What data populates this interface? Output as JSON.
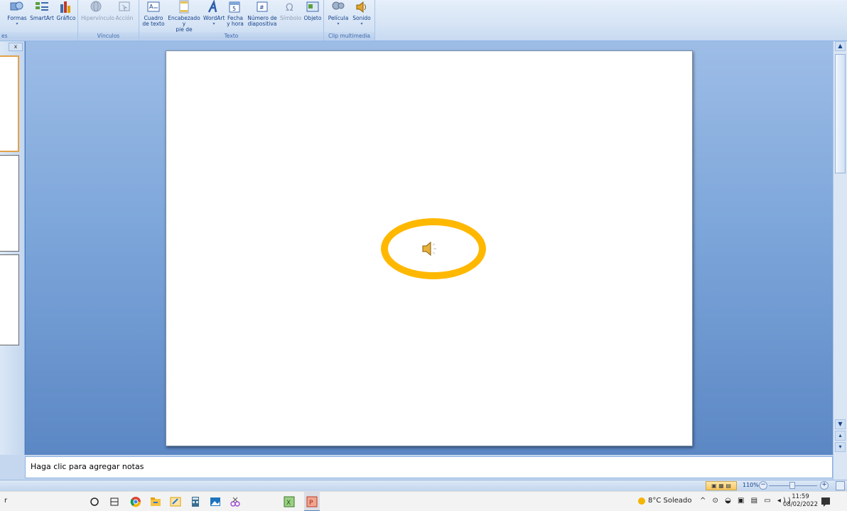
{
  "ribbon": {
    "groups": {
      "ilustraciones_partial": "es",
      "vinculos": "Vínculos",
      "texto": "Texto",
      "clip": "Clip multimedia"
    },
    "buttons": {
      "formas": "Formas",
      "smartart": "SmartArt",
      "grafico": "Gráfico",
      "hipervinculo": "Hipervínculo",
      "accion": "Acción",
      "cuadro_texto_1": "Cuadro",
      "cuadro_texto_2": "de texto",
      "encabezado_1": "Encabezado y",
      "encabezado_2": "pie de página",
      "wordart": "WordArt",
      "fecha_1": "Fecha",
      "fecha_2": "y hora",
      "numero_1": "Número de",
      "numero_2": "diapositiva",
      "simbolo": "Símbolo",
      "objeto": "Objeto",
      "pelicula": "Película",
      "sonido": "Sonido"
    }
  },
  "left_pane": {
    "close": "x"
  },
  "notes": {
    "placeholder": "Haga clic para agregar notas"
  },
  "statusbar": {
    "zoom": "110%",
    "zoom_value": 110
  },
  "taskbar": {
    "left_text": "r",
    "weather": "8°C Soleado",
    "time": "11:59",
    "date": "08/02/2022"
  },
  "colors": {
    "highlight": "#ffb800",
    "ribbon_text": "#15428b",
    "slide_bg_top": "#9dbde6",
    "slide_bg_bottom": "#5b87c4"
  }
}
